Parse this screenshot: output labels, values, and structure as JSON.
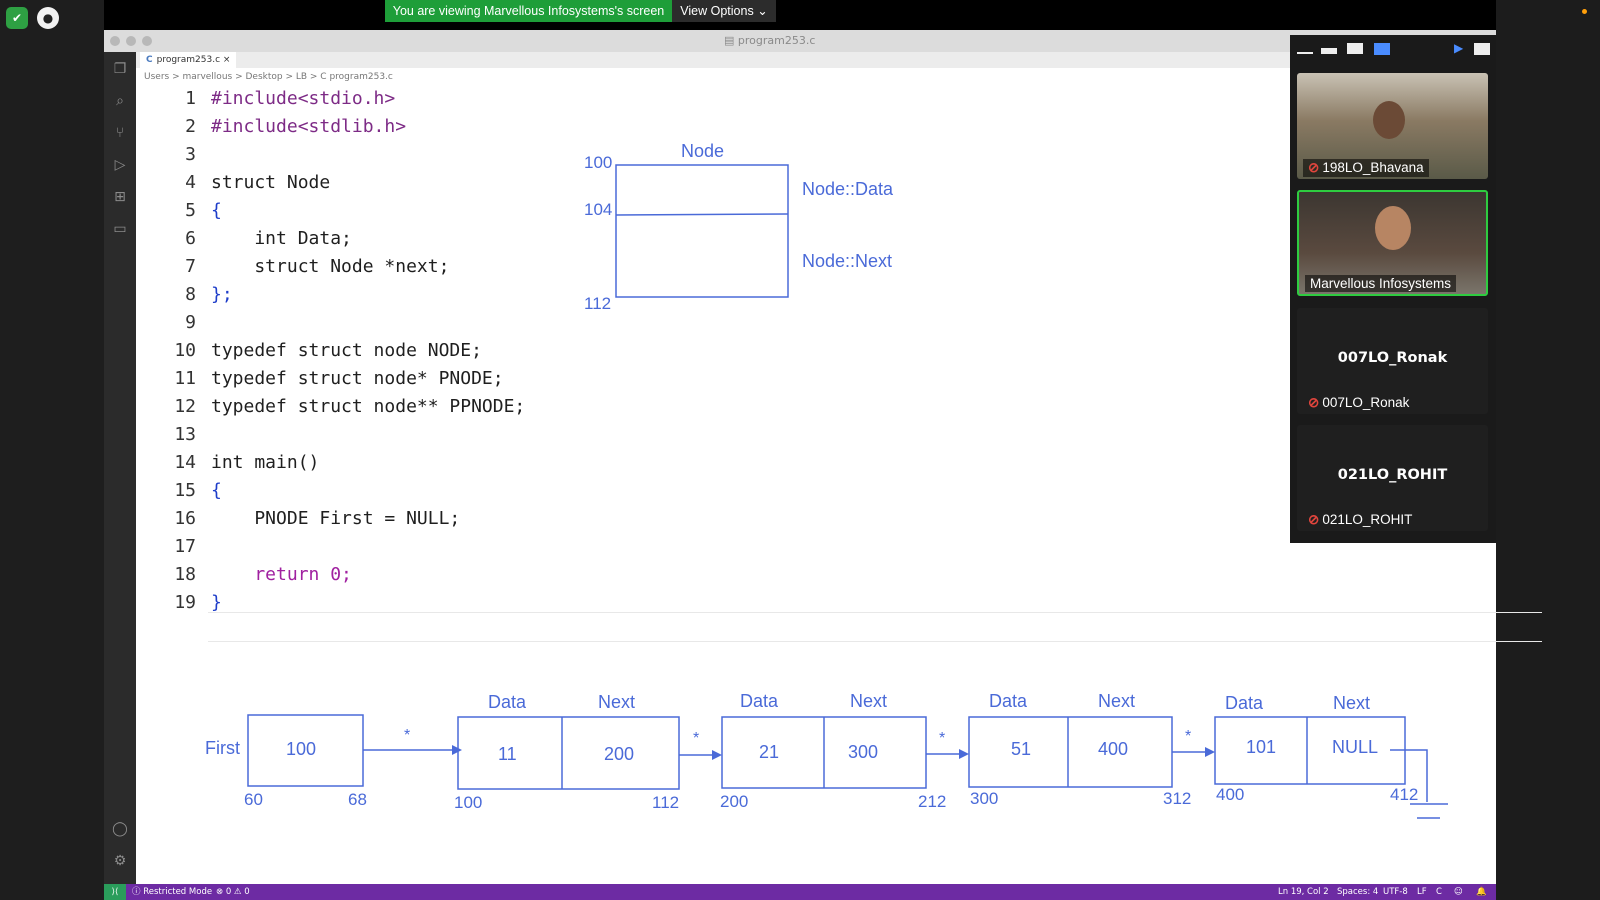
{
  "share_banner": {
    "text": "You are viewing Marvellous Infosystems's screen",
    "view_options": "View Options"
  },
  "editor": {
    "window_title": "program253.c",
    "tab_label": "program253.c",
    "breadcrumb": "Users > marvellous > Desktop > LB > C program253.c",
    "lines": [
      "#include<stdio.h>",
      "#include<stdlib.h>",
      "",
      "struct Node",
      "{",
      "    int Data;",
      "    struct Node *next;",
      "};",
      "",
      "typedef struct node NODE;",
      "typedef struct node* PNODE;",
      "typedef struct node** PPNODE;",
      "",
      "int main()",
      "{",
      "    PNODE First = NULL;",
      "",
      "    return 0;",
      "}"
    ]
  },
  "node_diagram": {
    "title": "Node",
    "addresses": [
      "100",
      "104",
      "112"
    ],
    "fields": [
      "Node::Data",
      "Node::Next"
    ]
  },
  "list_diagram": {
    "first_label": "First",
    "first_value": "100",
    "first_addresses": [
      "60",
      "68"
    ],
    "star": "*",
    "field_labels": [
      "Data",
      "Next"
    ],
    "nodes": [
      {
        "data": "11",
        "next": "200",
        "start": "100",
        "end": "112"
      },
      {
        "data": "21",
        "next": "300",
        "start": "200",
        "end": "212"
      },
      {
        "data": "51",
        "next": "400",
        "start": "300",
        "end": "312"
      },
      {
        "data": "101",
        "next": "NULL",
        "start": "400",
        "end": "412"
      }
    ]
  },
  "status_bar": {
    "restricted": "Restricted Mode",
    "problems": "⊗ 0 ⚠ 0",
    "cursor": "Ln 19, Col 2",
    "spaces": "Spaces: 4",
    "encoding": "UTF-8",
    "eol": "LF",
    "language": "C"
  },
  "participants": [
    {
      "name": "198LO_Bhavana",
      "muted": true,
      "video": true
    },
    {
      "name": "Marvellous Infosystems",
      "muted": false,
      "video": true,
      "active": true
    },
    {
      "name": "007LO_Ronak",
      "muted": true,
      "video": false
    },
    {
      "name": "021LO_ROHIT",
      "muted": true,
      "video": false
    }
  ]
}
